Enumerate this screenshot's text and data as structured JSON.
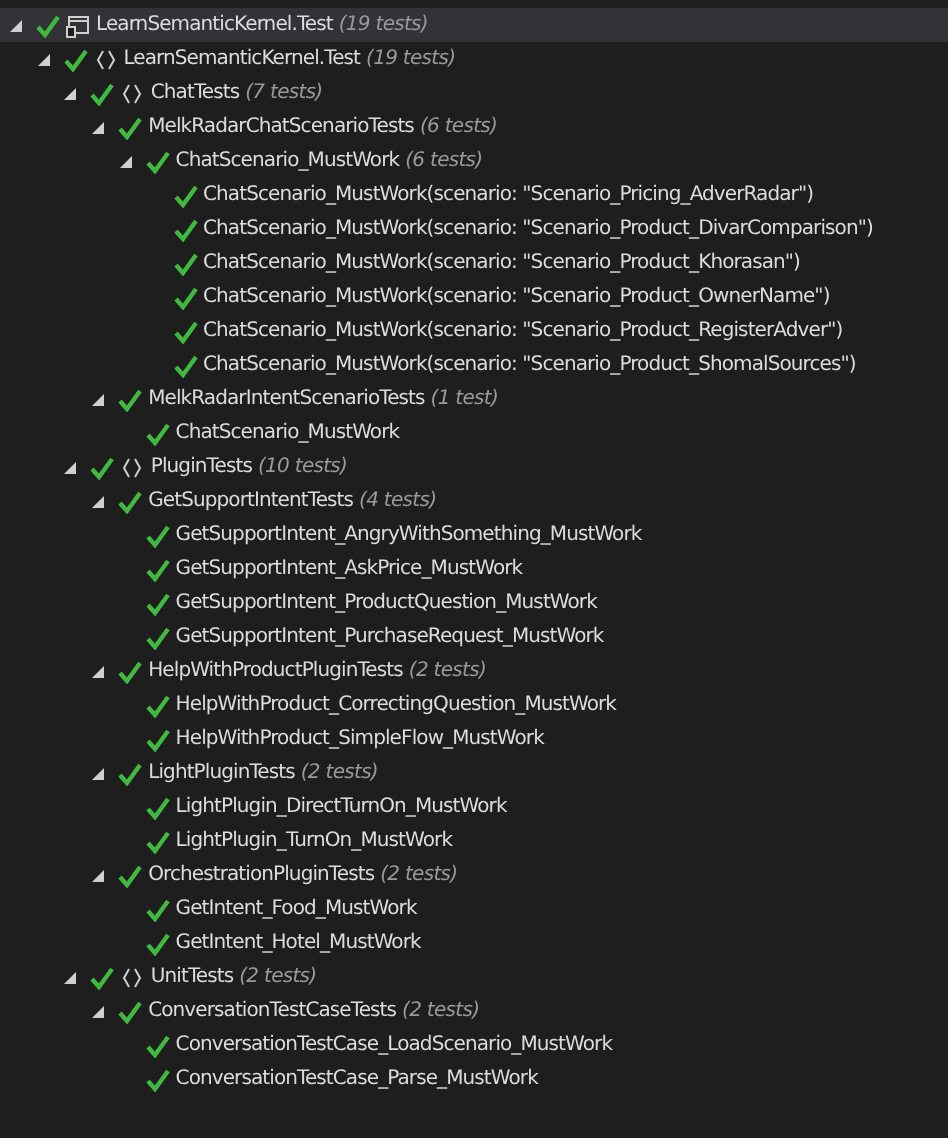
{
  "tree": [
    {
      "kind": "project",
      "name": "LearnSemanticKernel.Test",
      "count": "(19 tests)",
      "passed": true,
      "expanded": true,
      "selected": true,
      "children": [
        {
          "kind": "namespace",
          "name": "LearnSemanticKernel.Test",
          "count": "(19 tests)",
          "passed": true,
          "expanded": true,
          "selected": false,
          "children": [
            {
              "kind": "namespace",
              "name": "ChatTests",
              "count": "(7 tests)",
              "passed": true,
              "expanded": true,
              "selected": false,
              "children": [
                {
                  "name": "MelkRadarChatScenarioTests",
                  "count": "(6 tests)",
                  "passed": true,
                  "expanded": true,
                  "selected": false,
                  "children": [
                    {
                      "name": "ChatScenario_MustWork",
                      "count": "(6 tests)",
                      "passed": true,
                      "expanded": true,
                      "selected": false,
                      "children": [
                        {
                          "name": "ChatScenario_MustWork(scenario: \"Scenario_Pricing_AdverRadar\")",
                          "passed": true,
                          "selected": false
                        },
                        {
                          "name": "ChatScenario_MustWork(scenario: \"Scenario_Product_DivarComparison\")",
                          "passed": true,
                          "selected": false
                        },
                        {
                          "name": "ChatScenario_MustWork(scenario: \"Scenario_Product_Khorasan\")",
                          "passed": true,
                          "selected": false
                        },
                        {
                          "name": "ChatScenario_MustWork(scenario: \"Scenario_Product_OwnerName\")",
                          "passed": true,
                          "selected": false
                        },
                        {
                          "name": "ChatScenario_MustWork(scenario: \"Scenario_Product_RegisterAdver\")",
                          "passed": true,
                          "selected": false
                        },
                        {
                          "name": "ChatScenario_MustWork(scenario: \"Scenario_Product_ShomalSources\")",
                          "passed": true,
                          "selected": false
                        }
                      ]
                    }
                  ]
                },
                {
                  "name": "MelkRadarIntentScenarioTests",
                  "count": "(1 test)",
                  "passed": true,
                  "expanded": true,
                  "selected": false,
                  "children": [
                    {
                      "name": "ChatScenario_MustWork",
                      "passed": true,
                      "selected": false
                    }
                  ]
                }
              ]
            },
            {
              "kind": "namespace",
              "name": "PluginTests",
              "count": "(10 tests)",
              "passed": true,
              "expanded": true,
              "selected": false,
              "children": [
                {
                  "name": "GetSupportIntentTests",
                  "count": "(4 tests)",
                  "passed": true,
                  "expanded": true,
                  "selected": false,
                  "children": [
                    {
                      "name": "GetSupportIntent_AngryWithSomething_MustWork",
                      "passed": true,
                      "selected": false
                    },
                    {
                      "name": "GetSupportIntent_AskPrice_MustWork",
                      "passed": true,
                      "selected": false
                    },
                    {
                      "name": "GetSupportIntent_ProductQuestion_MustWork",
                      "passed": true,
                      "selected": false
                    },
                    {
                      "name": "GetSupportIntent_PurchaseRequest_MustWork",
                      "passed": true,
                      "selected": false
                    }
                  ]
                },
                {
                  "name": "HelpWithProductPluginTests",
                  "count": "(2 tests)",
                  "passed": true,
                  "expanded": true,
                  "selected": false,
                  "children": [
                    {
                      "name": "HelpWithProduct_CorrectingQuestion_MustWork",
                      "passed": true,
                      "selected": false
                    },
                    {
                      "name": "HelpWithProduct_SimpleFlow_MustWork",
                      "passed": true,
                      "selected": false
                    }
                  ]
                },
                {
                  "name": "LightPluginTests",
                  "count": "(2 tests)",
                  "passed": true,
                  "expanded": true,
                  "selected": false,
                  "children": [
                    {
                      "name": "LightPlugin_DirectTurnOn_MustWork",
                      "passed": true,
                      "selected": false
                    },
                    {
                      "name": "LightPlugin_TurnOn_MustWork",
                      "passed": true,
                      "selected": false
                    }
                  ]
                },
                {
                  "name": "OrchestrationPluginTests",
                  "count": "(2 tests)",
                  "passed": true,
                  "expanded": true,
                  "selected": false,
                  "children": [
                    {
                      "name": "GetIntent_Food_MustWork",
                      "passed": true,
                      "selected": false
                    },
                    {
                      "name": "GetIntent_Hotel_MustWork",
                      "passed": true,
                      "selected": false
                    }
                  ]
                }
              ]
            },
            {
              "kind": "namespace",
              "name": "UnitTests",
              "count": "(2 tests)",
              "passed": true,
              "expanded": true,
              "selected": false,
              "children": [
                {
                  "name": "ConversationTestCaseTests",
                  "count": "(2 tests)",
                  "passed": true,
                  "expanded": true,
                  "selected": false,
                  "children": [
                    {
                      "name": "ConversationTestCase_LoadScenario_MustWork",
                      "passed": true,
                      "selected": false
                    },
                    {
                      "name": "ConversationTestCase_Parse_MustWork",
                      "passed": true,
                      "selected": false
                    }
                  ]
                }
              ]
            }
          ]
        }
      ]
    }
  ]
}
